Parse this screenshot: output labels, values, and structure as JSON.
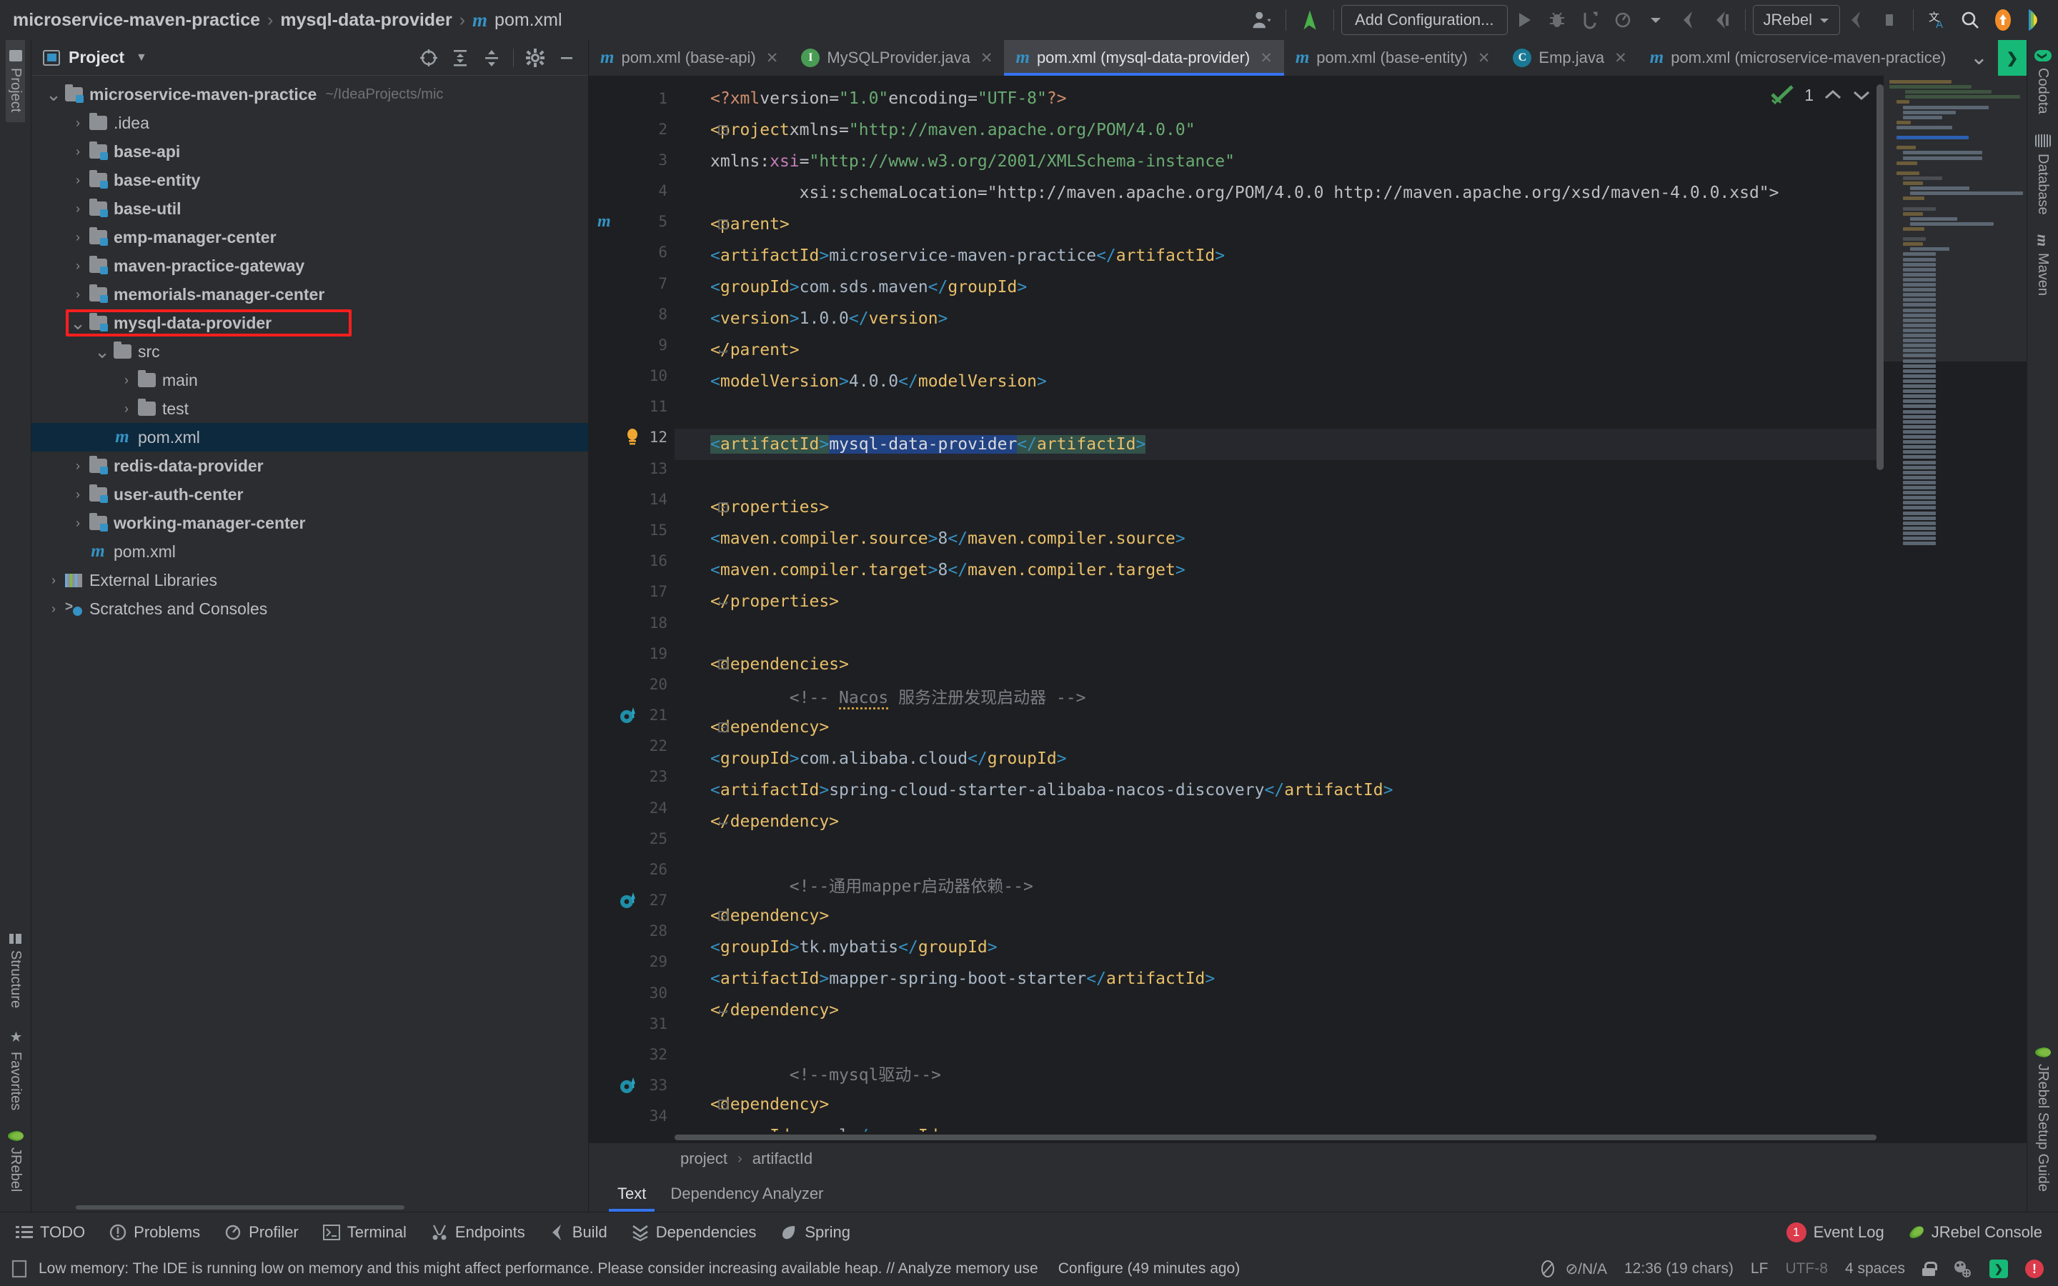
{
  "titlebar": {
    "breadcrumbs": [
      "microservice-maven-practice",
      "mysql-data-provider",
      "pom.xml"
    ],
    "run_config_label": "Add Configuration...",
    "jrebel_label": "JRebel",
    "icons": [
      "user-avatar-icon",
      "vcs-update-icon",
      "run-icon",
      "debug-icon",
      "coverage-icon",
      "profile-icon",
      "build-icon",
      "build-all-icon",
      "stop-icon",
      "square-stop-icon",
      "translate-icon",
      "search-icon",
      "update-arrow-icon",
      "ide-logo-icon"
    ]
  },
  "left_rail": {
    "top": [
      {
        "label": "Project",
        "icon": "project-icon",
        "active": true
      }
    ],
    "bottom": [
      {
        "label": "Structure",
        "icon": "structure-icon",
        "active": false
      },
      {
        "label": "Favorites",
        "icon": "star-icon",
        "active": false
      },
      {
        "label": "JRebel",
        "icon": "jrebel-icon",
        "active": false
      }
    ]
  },
  "project_panel": {
    "title": "Project",
    "toolbar_icons": [
      "locate-target-icon",
      "expand-all-icon",
      "collapse-all-icon",
      "gear-icon",
      "minimize-icon"
    ],
    "tree": [
      {
        "depth": 0,
        "arrow": "down",
        "icon": "module-folder",
        "label": "microservice-maven-practice",
        "bold": true,
        "hint": "~/IdeaProjects/mic"
      },
      {
        "depth": 1,
        "arrow": "right",
        "icon": "folder",
        "label": ".idea",
        "bold": false,
        "hint": ""
      },
      {
        "depth": 1,
        "arrow": "right",
        "icon": "module-folder",
        "label": "base-api",
        "bold": true,
        "hint": ""
      },
      {
        "depth": 1,
        "arrow": "right",
        "icon": "module-folder",
        "label": "base-entity",
        "bold": true,
        "hint": ""
      },
      {
        "depth": 1,
        "arrow": "right",
        "icon": "module-folder",
        "label": "base-util",
        "bold": true,
        "hint": ""
      },
      {
        "depth": 1,
        "arrow": "right",
        "icon": "module-folder",
        "label": "emp-manager-center",
        "bold": true,
        "hint": ""
      },
      {
        "depth": 1,
        "arrow": "right",
        "icon": "module-folder",
        "label": "maven-practice-gateway",
        "bold": true,
        "hint": ""
      },
      {
        "depth": 1,
        "arrow": "right",
        "icon": "module-folder",
        "label": "memorials-manager-center",
        "bold": true,
        "hint": ""
      },
      {
        "depth": 1,
        "arrow": "down",
        "icon": "module-folder",
        "label": "mysql-data-provider",
        "bold": true,
        "hint": "",
        "highlight": true
      },
      {
        "depth": 2,
        "arrow": "down",
        "icon": "folder",
        "label": "src",
        "bold": false,
        "hint": ""
      },
      {
        "depth": 3,
        "arrow": "right",
        "icon": "folder",
        "label": "main",
        "bold": false,
        "hint": ""
      },
      {
        "depth": 3,
        "arrow": "right",
        "icon": "folder",
        "label": "test",
        "bold": false,
        "hint": ""
      },
      {
        "depth": 2,
        "arrow": "none",
        "icon": "maven-file",
        "label": "pom.xml",
        "bold": false,
        "hint": "",
        "selected": true
      },
      {
        "depth": 1,
        "arrow": "right",
        "icon": "module-folder",
        "label": "redis-data-provider",
        "bold": true,
        "hint": ""
      },
      {
        "depth": 1,
        "arrow": "right",
        "icon": "module-folder",
        "label": "user-auth-center",
        "bold": true,
        "hint": ""
      },
      {
        "depth": 1,
        "arrow": "right",
        "icon": "module-folder",
        "label": "working-manager-center",
        "bold": true,
        "hint": ""
      },
      {
        "depth": 1,
        "arrow": "none",
        "icon": "maven-file",
        "label": "pom.xml",
        "bold": false,
        "hint": ""
      },
      {
        "depth": 0,
        "arrow": "right",
        "icon": "external-libs",
        "label": "External Libraries",
        "bold": false,
        "hint": ""
      },
      {
        "depth": 0,
        "arrow": "right",
        "icon": "scratches",
        "label": "Scratches and Consoles",
        "bold": false,
        "hint": ""
      }
    ]
  },
  "editor_tabs": [
    {
      "label": "pom.xml (base-api)",
      "icon": "maven-file",
      "active": false,
      "closable": true
    },
    {
      "label": "MySQLProvider.java",
      "icon": "interface-badge",
      "active": false,
      "closable": true
    },
    {
      "label": "pom.xml (mysql-data-provider)",
      "icon": "maven-file",
      "active": true,
      "closable": true
    },
    {
      "label": "pom.xml (base-entity)",
      "icon": "maven-file",
      "active": false,
      "closable": true
    },
    {
      "label": "Emp.java",
      "icon": "class-badge",
      "active": false,
      "closable": true
    },
    {
      "label": "pom.xml (microservice-maven-practice)",
      "icon": "maven-file",
      "active": false,
      "closable": false
    }
  ],
  "editor": {
    "inspection_count": "1",
    "line_numbers": [
      "1",
      "2",
      "3",
      "4",
      "5",
      "6",
      "7",
      "8",
      "9",
      "10",
      "11",
      "12",
      "13",
      "14",
      "15",
      "16",
      "17",
      "18",
      "19",
      "20",
      "21",
      "22",
      "23",
      "24",
      "25",
      "26",
      "27",
      "28",
      "29",
      "30",
      "31",
      "32",
      "33",
      "34"
    ],
    "caret_line": 12,
    "selected_text": "mysql-data-provider",
    "lines": [
      "<?xml version=\"1.0\" encoding=\"UTF-8\"?>",
      "<project xmlns=\"http://maven.apache.org/POM/4.0.0\"",
      "         xmlns:xsi=\"http://www.w3.org/2001/XMLSchema-instance\"",
      "         xsi:schemaLocation=\"http://maven.apache.org/POM/4.0.0 http://maven.apache.org/xsd/maven-4.0.0.xsd\">",
      "    <parent>",
      "        <artifactId>microservice-maven-practice</artifactId>",
      "        <groupId>com.sds.maven</groupId>",
      "        <version>1.0.0</version>",
      "    </parent>",
      "    <modelVersion>4.0.0</modelVersion>",
      "",
      "    <artifactId>mysql-data-provider</artifactId>",
      "",
      "    <properties>",
      "        <maven.compiler.source>8</maven.compiler.source>",
      "        <maven.compiler.target>8</maven.compiler.target>",
      "    </properties>",
      "",
      "    <dependencies>",
      "        <!-- Nacos 服务注册发现启动器 -->",
      "        <dependency>",
      "            <groupId>com.alibaba.cloud</groupId>",
      "            <artifactId>spring-cloud-starter-alibaba-nacos-discovery</artifactId>",
      "        </dependency>",
      "",
      "        <!--通用mapper启动器依赖-->",
      "        <dependency>",
      "            <groupId>tk.mybatis</groupId>",
      "            <artifactId>mapper-spring-boot-starter</artifactId>",
      "        </dependency>",
      "",
      "        <!--mysql驱动-->",
      "        <dependency>",
      "            <groupId>mysql</groupId>"
    ]
  },
  "editor_breadcrumb": [
    "project",
    "artifactId"
  ],
  "sub_tabs": [
    {
      "label": "Text",
      "active": true
    },
    {
      "label": "Dependency Analyzer",
      "active": false
    }
  ],
  "right_rail": [
    {
      "label": "Codota",
      "icon": "codota-icon"
    },
    {
      "label": "Database",
      "icon": "database-icon"
    },
    {
      "label": "Maven",
      "icon": "maven-icon"
    },
    {
      "label": "JRebel Setup Guide",
      "icon": "jrebel-icon"
    }
  ],
  "tool_windows": [
    {
      "label": "TODO",
      "icon": "todo-icon"
    },
    {
      "label": "Problems",
      "icon": "problems-icon"
    },
    {
      "label": "Profiler",
      "icon": "profiler-icon"
    },
    {
      "label": "Terminal",
      "icon": "terminal-icon"
    },
    {
      "label": "Endpoints",
      "icon": "endpoints-icon"
    },
    {
      "label": "Build",
      "icon": "build-icon"
    },
    {
      "label": "Dependencies",
      "icon": "dependencies-icon"
    },
    {
      "label": "Spring",
      "icon": "spring-icon"
    }
  ],
  "tool_windows_right": [
    {
      "label": "Event Log",
      "icon": "event-log-icon",
      "badge": "1"
    },
    {
      "label": "JRebel Console",
      "icon": "jrebel-icon",
      "badge": ""
    }
  ],
  "status_bar": {
    "message": "Low memory: The IDE is running low on memory and this might affect performance. Please consider increasing available heap. // Analyze memory use",
    "configure": "Configure (49 minutes ago)",
    "vcs": "⊘/N/A",
    "caret": "12:36 (19 chars)",
    "line_sep": "LF",
    "encoding": "UTF-8",
    "indent": "4 spaces",
    "icons": [
      "lock-icon",
      "inspections-icon",
      "codota-icon",
      "error-icon"
    ]
  },
  "colors": {
    "accent_blue": "#3574f0",
    "maven_blue": "#3592c4",
    "tag": "#e8bf6a",
    "string": "#6aab73",
    "comment": "#7a7e85",
    "selection": "#214283",
    "highlight_red": "#fc1f1f",
    "green": "#499c54"
  }
}
